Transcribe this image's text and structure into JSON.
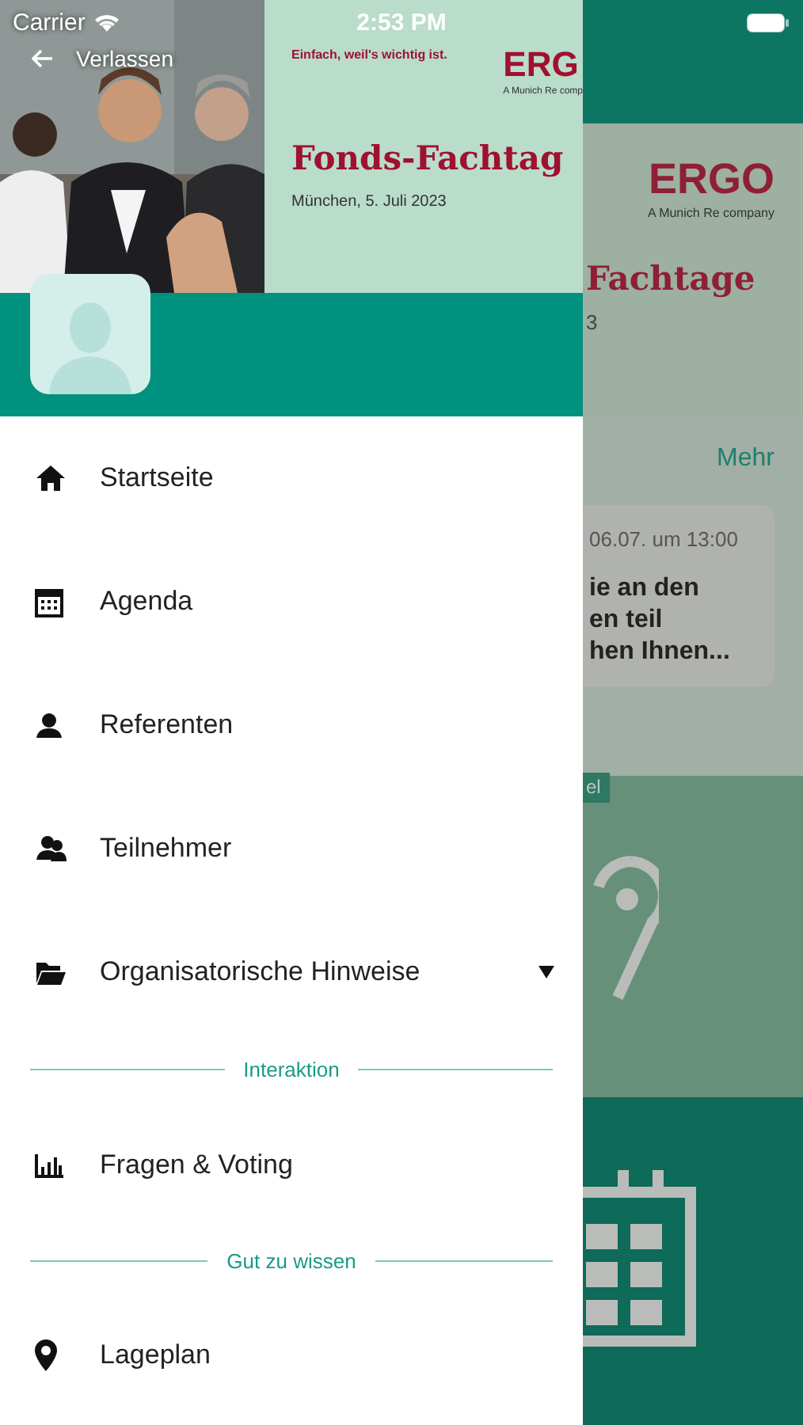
{
  "status_bar": {
    "carrier": "Carrier",
    "time": "2:53 PM"
  },
  "drawer": {
    "back_label": "Verlassen",
    "header": {
      "tagline": "Einfach, weil's wichtig ist.",
      "logo": "ERG",
      "logo_sub": "A Munich Re comp",
      "title": "Fonds-Fachtag",
      "date": "München, 5. Juli 2023"
    },
    "menu": [
      {
        "kind": "item",
        "label": "Startseite"
      },
      {
        "kind": "item",
        "label": "Agenda"
      },
      {
        "kind": "item",
        "label": "Referenten"
      },
      {
        "kind": "item",
        "label": "Teilnehmer"
      },
      {
        "kind": "group",
        "label": "Organisatorische Hinweise",
        "expanded": false
      },
      {
        "kind": "section",
        "label": "Interaktion"
      },
      {
        "kind": "item",
        "label": "Fragen & Voting"
      },
      {
        "kind": "section",
        "label": "Gut zu wissen"
      },
      {
        "kind": "item",
        "label": "Lageplan"
      }
    ]
  },
  "background": {
    "banner": {
      "logo": "ERGO",
      "logo_sub": "A Munich Re company",
      "title": "Fachtage",
      "date": "3"
    },
    "more_link": "Mehr",
    "card": {
      "time": "06.07. um 13:00",
      "lines": [
        "ie an den",
        "en teil",
        "hen Ihnen..."
      ]
    },
    "tag": "el"
  }
}
